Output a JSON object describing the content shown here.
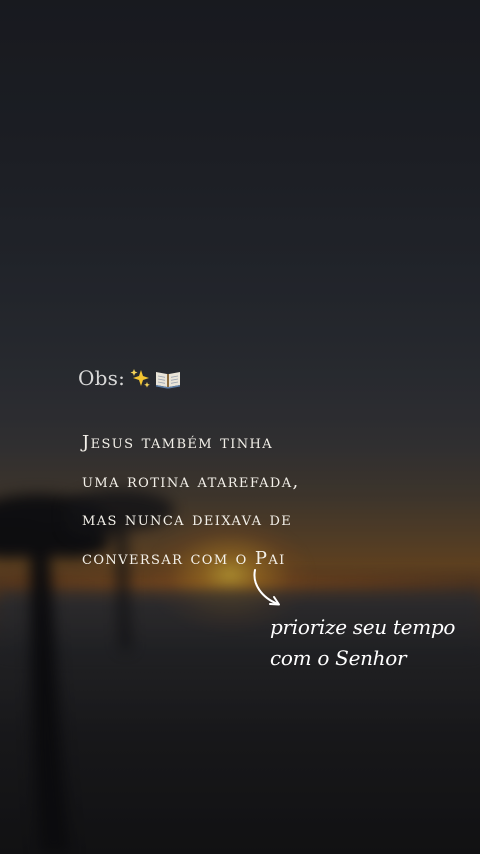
{
  "overlay_text": {
    "obs_label": "Obs:",
    "obs_icons": [
      "sparkles-icon",
      "open-book-icon"
    ],
    "verse_lines": [
      "Jesus também tinha",
      "uma rotina atarefada,",
      "mas nunca deixava de",
      "conversar com o Pai"
    ],
    "note_lines": [
      "priorize seu tempo",
      "com o Senhor"
    ]
  },
  "colors": {
    "sky_top": "#1e2026",
    "sunset_glow": "#d89632",
    "text_primary": "#f4f1ea",
    "obs_text": "#d8d8d8"
  }
}
